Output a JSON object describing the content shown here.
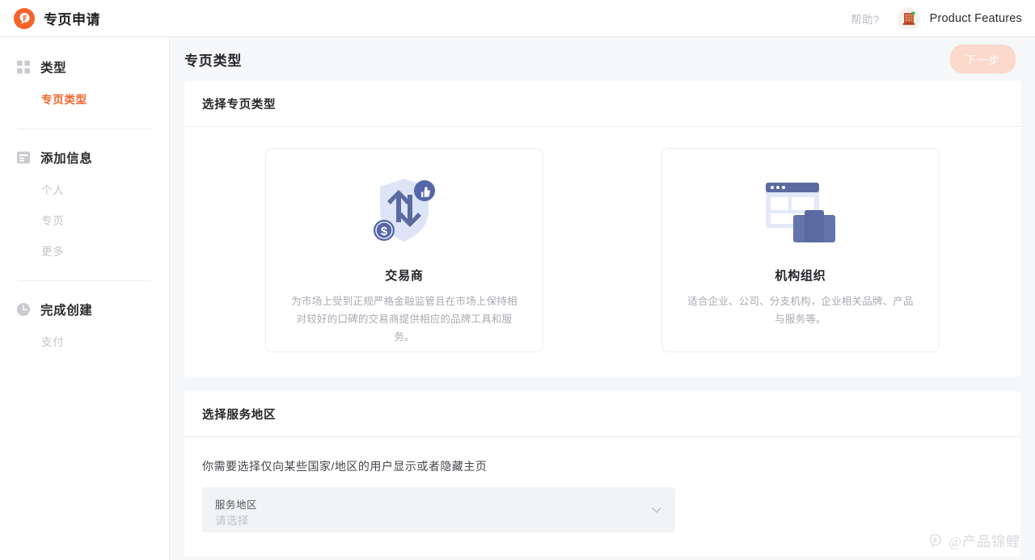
{
  "header": {
    "logo_icon": "flamingo-f-logo-icon",
    "app_title": "专页申请",
    "help_label": "帮助?",
    "avatar_icon": "building-avatar-icon",
    "user_name": "Product Features"
  },
  "sidebar": {
    "groups": [
      {
        "icon": "grid-icon",
        "label": "类型",
        "items": [
          {
            "label": "专页类型",
            "active": true
          }
        ]
      },
      {
        "icon": "document-list-icon",
        "label": "添加信息",
        "items": [
          {
            "label": "个人",
            "active": false
          },
          {
            "label": "专页",
            "active": false
          },
          {
            "label": "更多",
            "active": false
          }
        ]
      },
      {
        "icon": "clock-icon",
        "label": "完成创建",
        "items": [
          {
            "label": "支付",
            "active": false
          }
        ]
      }
    ]
  },
  "page": {
    "title": "专页类型",
    "next_button": "下一步"
  },
  "type_panel": {
    "heading": "选择专页类型",
    "cards": [
      {
        "icon": "shield-exchange-icon",
        "name": "交易商",
        "description": "为市场上受到正规严格金融监管且在市场上保持相对较好的口碑的交易商提供相应的品牌工具和服务。"
      },
      {
        "icon": "browser-briefcase-icon",
        "name": "机构组织",
        "description": "适合企业、公司、分支机构，企业相关品牌、产品与服务等。"
      }
    ]
  },
  "region_panel": {
    "heading": "选择服务地区",
    "note": "你需要选择仅向某些国家/地区的用户显示或者隐藏主页",
    "select": {
      "label": "服务地区",
      "placeholder": "请选择",
      "value": "请选择",
      "chevron_icon": "chevron-down-icon"
    }
  },
  "watermark": {
    "glyph_icon": "watermark-logo-icon",
    "text": "@产品锦鲤"
  },
  "colors": {
    "accent": "#f4642a",
    "accent_disabled": "#fbd9cb",
    "card_icon_dark": "#5b6aa0",
    "card_icon_light": "#dce4f7",
    "content_bg": "#f6f7f9",
    "field_bg": "#f2f3f5"
  }
}
